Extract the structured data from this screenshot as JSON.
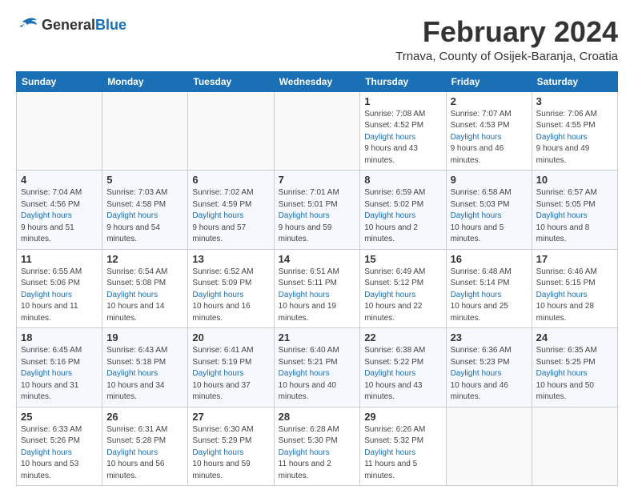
{
  "header": {
    "logo_general": "General",
    "logo_blue": "Blue",
    "month_title": "February 2024",
    "subtitle": "Trnava, County of Osijek-Baranja, Croatia"
  },
  "weekdays": [
    "Sunday",
    "Monday",
    "Tuesday",
    "Wednesday",
    "Thursday",
    "Friday",
    "Saturday"
  ],
  "weeks": [
    [
      {
        "day": "",
        "sunrise": "",
        "sunset": "",
        "daylight": ""
      },
      {
        "day": "",
        "sunrise": "",
        "sunset": "",
        "daylight": ""
      },
      {
        "day": "",
        "sunrise": "",
        "sunset": "",
        "daylight": ""
      },
      {
        "day": "",
        "sunrise": "",
        "sunset": "",
        "daylight": ""
      },
      {
        "day": "1",
        "sunrise": "Sunrise: 7:08 AM",
        "sunset": "Sunset: 4:52 PM",
        "daylight": "Daylight: 9 hours and 43 minutes."
      },
      {
        "day": "2",
        "sunrise": "Sunrise: 7:07 AM",
        "sunset": "Sunset: 4:53 PM",
        "daylight": "Daylight: 9 hours and 46 minutes."
      },
      {
        "day": "3",
        "sunrise": "Sunrise: 7:06 AM",
        "sunset": "Sunset: 4:55 PM",
        "daylight": "Daylight: 9 hours and 49 minutes."
      }
    ],
    [
      {
        "day": "4",
        "sunrise": "Sunrise: 7:04 AM",
        "sunset": "Sunset: 4:56 PM",
        "daylight": "Daylight: 9 hours and 51 minutes."
      },
      {
        "day": "5",
        "sunrise": "Sunrise: 7:03 AM",
        "sunset": "Sunset: 4:58 PM",
        "daylight": "Daylight: 9 hours and 54 minutes."
      },
      {
        "day": "6",
        "sunrise": "Sunrise: 7:02 AM",
        "sunset": "Sunset: 4:59 PM",
        "daylight": "Daylight: 9 hours and 57 minutes."
      },
      {
        "day": "7",
        "sunrise": "Sunrise: 7:01 AM",
        "sunset": "Sunset: 5:01 PM",
        "daylight": "Daylight: 9 hours and 59 minutes."
      },
      {
        "day": "8",
        "sunrise": "Sunrise: 6:59 AM",
        "sunset": "Sunset: 5:02 PM",
        "daylight": "Daylight: 10 hours and 2 minutes."
      },
      {
        "day": "9",
        "sunrise": "Sunrise: 6:58 AM",
        "sunset": "Sunset: 5:03 PM",
        "daylight": "Daylight: 10 hours and 5 minutes."
      },
      {
        "day": "10",
        "sunrise": "Sunrise: 6:57 AM",
        "sunset": "Sunset: 5:05 PM",
        "daylight": "Daylight: 10 hours and 8 minutes."
      }
    ],
    [
      {
        "day": "11",
        "sunrise": "Sunrise: 6:55 AM",
        "sunset": "Sunset: 5:06 PM",
        "daylight": "Daylight: 10 hours and 11 minutes."
      },
      {
        "day": "12",
        "sunrise": "Sunrise: 6:54 AM",
        "sunset": "Sunset: 5:08 PM",
        "daylight": "Daylight: 10 hours and 14 minutes."
      },
      {
        "day": "13",
        "sunrise": "Sunrise: 6:52 AM",
        "sunset": "Sunset: 5:09 PM",
        "daylight": "Daylight: 10 hours and 16 minutes."
      },
      {
        "day": "14",
        "sunrise": "Sunrise: 6:51 AM",
        "sunset": "Sunset: 5:11 PM",
        "daylight": "Daylight: 10 hours and 19 minutes."
      },
      {
        "day": "15",
        "sunrise": "Sunrise: 6:49 AM",
        "sunset": "Sunset: 5:12 PM",
        "daylight": "Daylight: 10 hours and 22 minutes."
      },
      {
        "day": "16",
        "sunrise": "Sunrise: 6:48 AM",
        "sunset": "Sunset: 5:14 PM",
        "daylight": "Daylight: 10 hours and 25 minutes."
      },
      {
        "day": "17",
        "sunrise": "Sunrise: 6:46 AM",
        "sunset": "Sunset: 5:15 PM",
        "daylight": "Daylight: 10 hours and 28 minutes."
      }
    ],
    [
      {
        "day": "18",
        "sunrise": "Sunrise: 6:45 AM",
        "sunset": "Sunset: 5:16 PM",
        "daylight": "Daylight: 10 hours and 31 minutes."
      },
      {
        "day": "19",
        "sunrise": "Sunrise: 6:43 AM",
        "sunset": "Sunset: 5:18 PM",
        "daylight": "Daylight: 10 hours and 34 minutes."
      },
      {
        "day": "20",
        "sunrise": "Sunrise: 6:41 AM",
        "sunset": "Sunset: 5:19 PM",
        "daylight": "Daylight: 10 hours and 37 minutes."
      },
      {
        "day": "21",
        "sunrise": "Sunrise: 6:40 AM",
        "sunset": "Sunset: 5:21 PM",
        "daylight": "Daylight: 10 hours and 40 minutes."
      },
      {
        "day": "22",
        "sunrise": "Sunrise: 6:38 AM",
        "sunset": "Sunset: 5:22 PM",
        "daylight": "Daylight: 10 hours and 43 minutes."
      },
      {
        "day": "23",
        "sunrise": "Sunrise: 6:36 AM",
        "sunset": "Sunset: 5:23 PM",
        "daylight": "Daylight: 10 hours and 46 minutes."
      },
      {
        "day": "24",
        "sunrise": "Sunrise: 6:35 AM",
        "sunset": "Sunset: 5:25 PM",
        "daylight": "Daylight: 10 hours and 50 minutes."
      }
    ],
    [
      {
        "day": "25",
        "sunrise": "Sunrise: 6:33 AM",
        "sunset": "Sunset: 5:26 PM",
        "daylight": "Daylight: 10 hours and 53 minutes."
      },
      {
        "day": "26",
        "sunrise": "Sunrise: 6:31 AM",
        "sunset": "Sunset: 5:28 PM",
        "daylight": "Daylight: 10 hours and 56 minutes."
      },
      {
        "day": "27",
        "sunrise": "Sunrise: 6:30 AM",
        "sunset": "Sunset: 5:29 PM",
        "daylight": "Daylight: 10 hours and 59 minutes."
      },
      {
        "day": "28",
        "sunrise": "Sunrise: 6:28 AM",
        "sunset": "Sunset: 5:30 PM",
        "daylight": "Daylight: 11 hours and 2 minutes."
      },
      {
        "day": "29",
        "sunrise": "Sunrise: 6:26 AM",
        "sunset": "Sunset: 5:32 PM",
        "daylight": "Daylight: 11 hours and 5 minutes."
      },
      {
        "day": "",
        "sunrise": "",
        "sunset": "",
        "daylight": ""
      },
      {
        "day": "",
        "sunrise": "",
        "sunset": "",
        "daylight": ""
      }
    ]
  ]
}
